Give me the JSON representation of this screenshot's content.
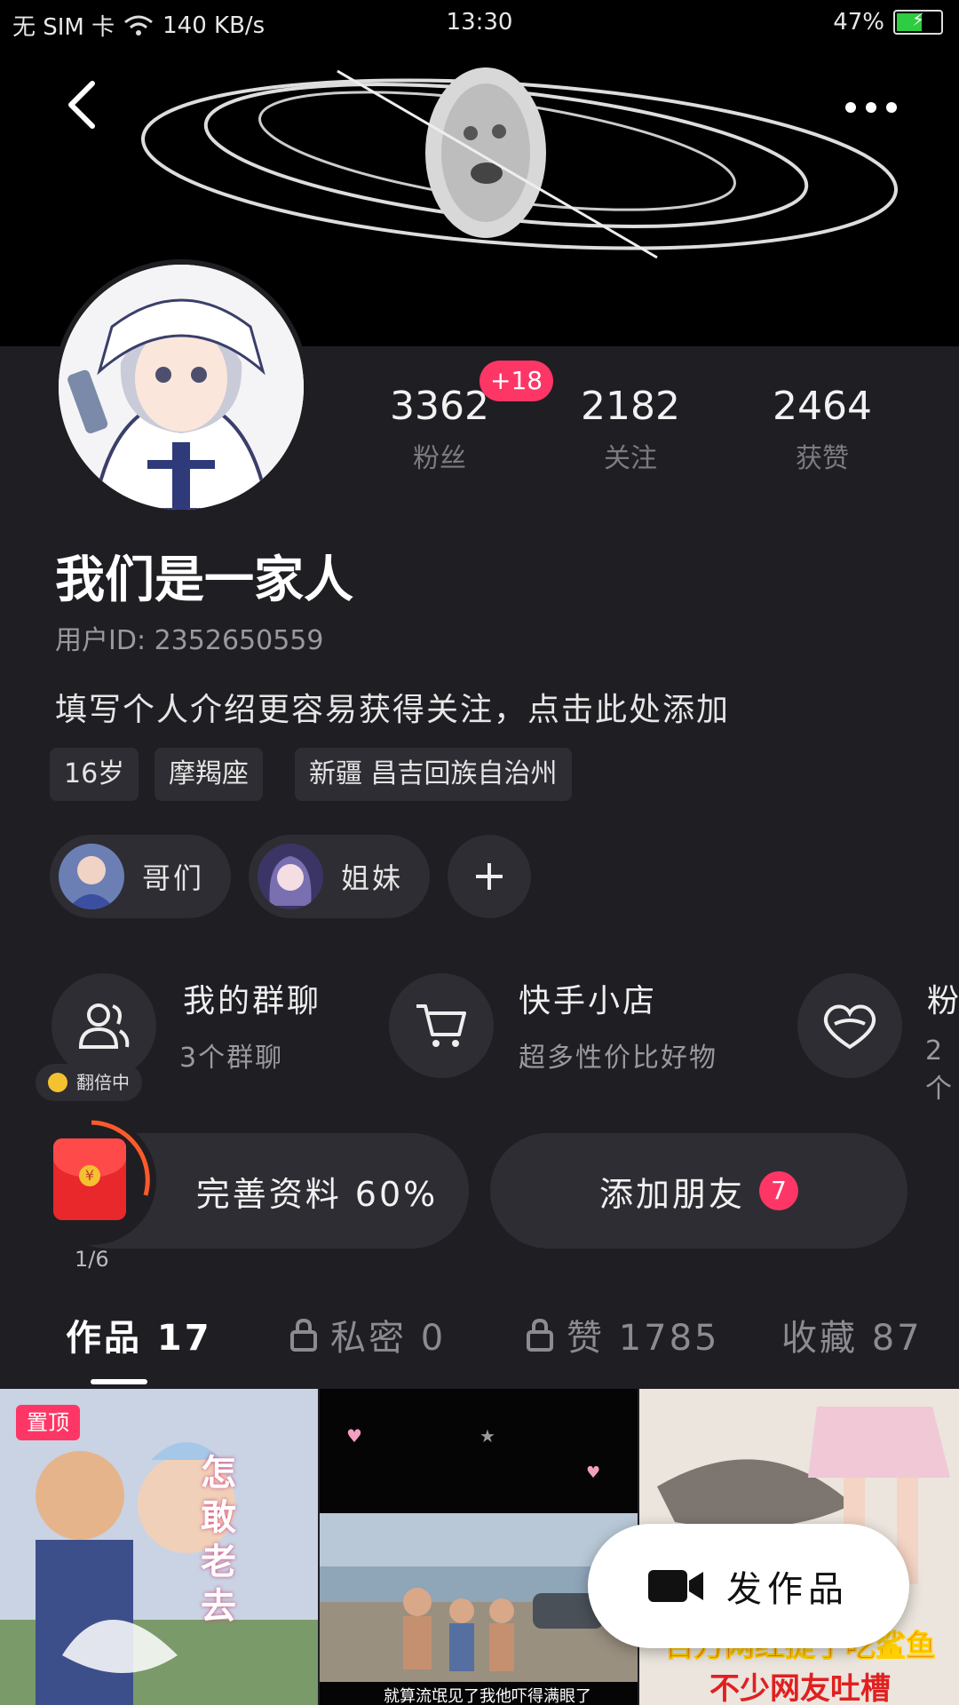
{
  "status_bar": {
    "carrier": "无 SIM 卡",
    "speed": "140 KB/s",
    "time": "13:30",
    "battery": "47%"
  },
  "profile": {
    "new_fans_badge": "+18",
    "stats": [
      {
        "value": "3362",
        "label": "粉丝"
      },
      {
        "value": "2182",
        "label": "关注"
      },
      {
        "value": "2464",
        "label": "获赞"
      }
    ],
    "name": "我们是一家人",
    "user_id": "用户ID: 2352650559",
    "bio": "填写个人介绍更容易获得关注，点击此处添加",
    "tags": [
      "16岁",
      "摩羯座",
      "新疆 昌吉回族自治州"
    ],
    "circles": [
      {
        "label": "哥们"
      },
      {
        "label": "姐妹"
      }
    ]
  },
  "entries": [
    {
      "title": "我的群聊",
      "subtitle": "3个群聊",
      "icon": "group-icon"
    },
    {
      "title": "快手小店",
      "subtitle": "超多性价比好物",
      "icon": "cart-icon"
    },
    {
      "title": "粉",
      "subtitle": "2个",
      "icon": "heart-icon"
    }
  ],
  "actions": {
    "double_label": "翻倍中",
    "complete_profile": "完善资料 60%",
    "add_friend": "添加朋友",
    "add_friend_badge": "7",
    "redpack_progress": "1/6"
  },
  "tabs": [
    {
      "label": "作品 17",
      "locked": false,
      "active": true
    },
    {
      "label": "私密 0",
      "locked": true,
      "active": false
    },
    {
      "label": "赞 1785",
      "locked": true,
      "active": false
    },
    {
      "label": "收藏 87",
      "locked": false,
      "active": false
    }
  ],
  "grid": {
    "pin_label": "置顶",
    "thumb1_text": "怎敢老去",
    "thumb2_caption": "就算流氓见了我他吓得满眼了",
    "thumb3_caption_1": "百万网红提子吃鲨鱼",
    "thumb3_caption_2": "不少网友吐槽"
  },
  "publish_label": "发作品",
  "colors": {
    "accent": "#fe3666",
    "background": "#1f1e23",
    "card": "#2e2d33"
  }
}
